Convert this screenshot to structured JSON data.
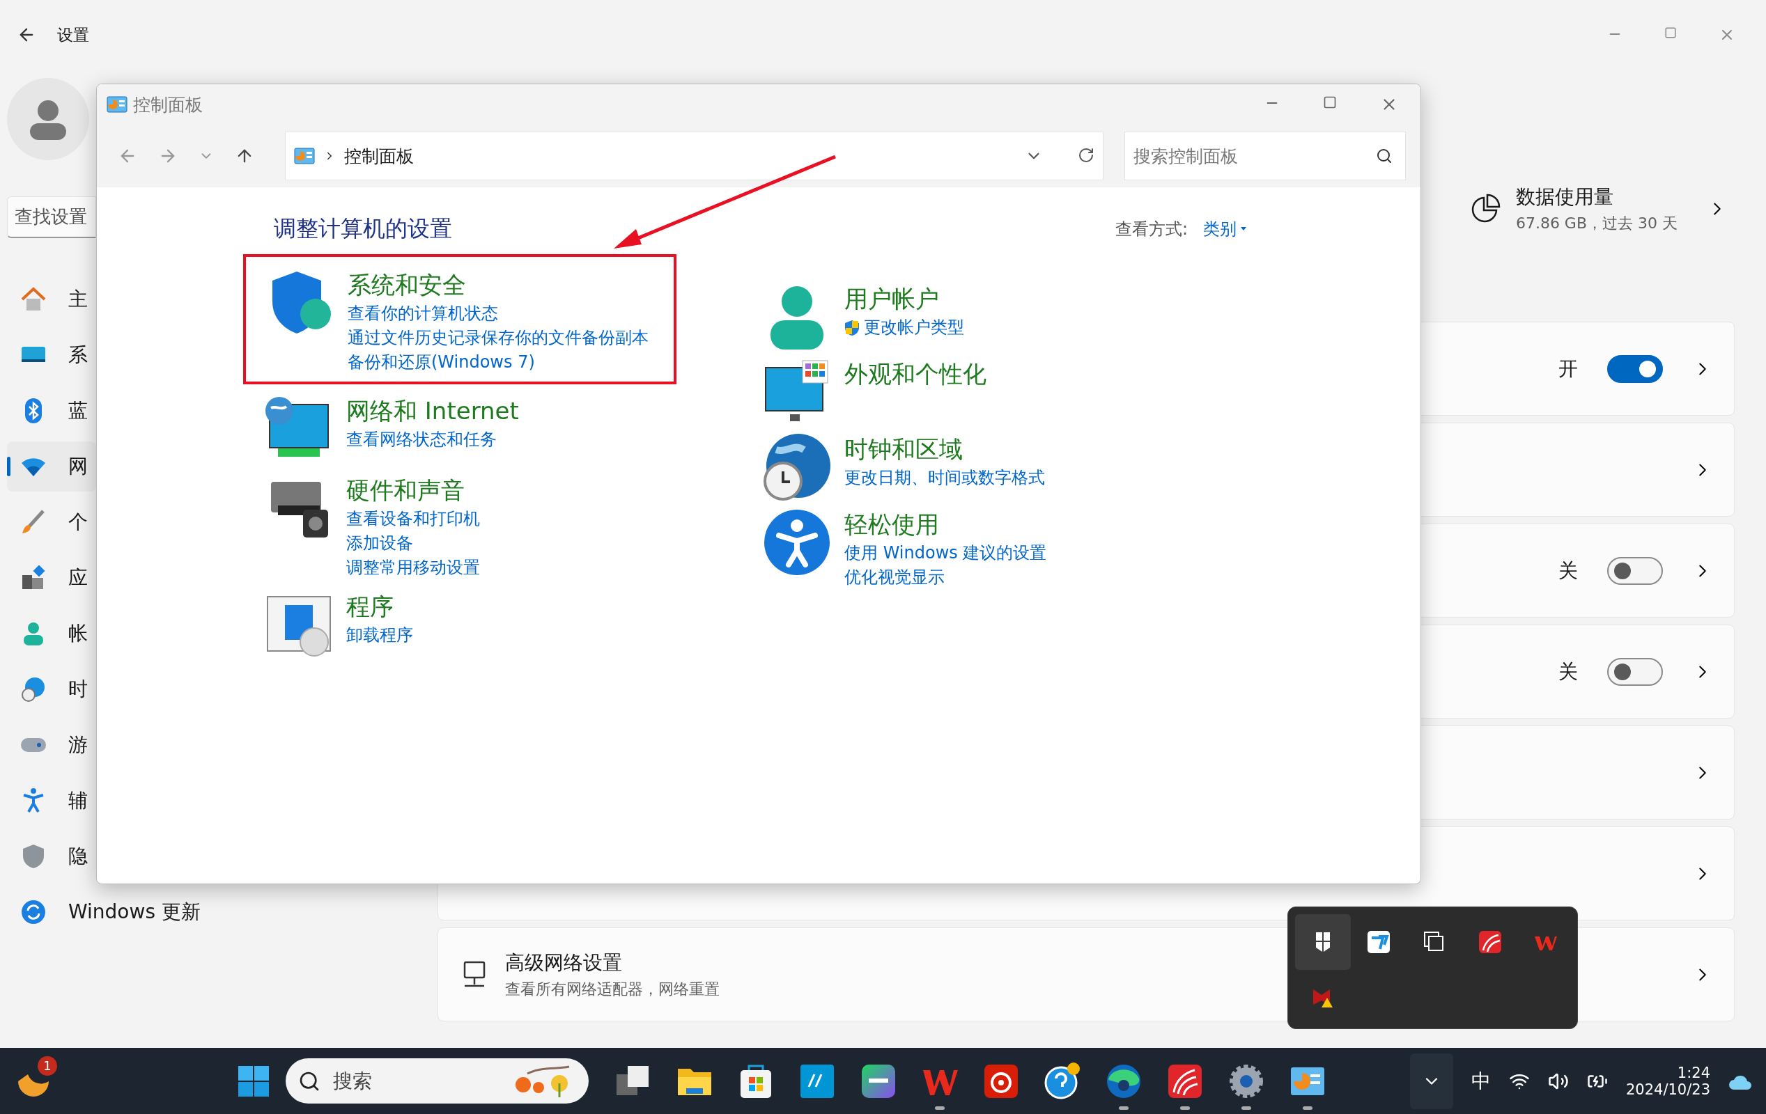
{
  "settings": {
    "title": "设置",
    "search_placeholder": "查找设置",
    "nav": [
      {
        "kind": "home",
        "label": "主",
        "selected": false
      },
      {
        "kind": "system",
        "label": "系",
        "selected": false
      },
      {
        "kind": "bluetooth",
        "label": "蓝",
        "selected": false
      },
      {
        "kind": "network",
        "label": "网",
        "selected": true
      },
      {
        "kind": "brush",
        "label": "个",
        "selected": false
      },
      {
        "kind": "apps",
        "label": "应",
        "selected": false
      },
      {
        "kind": "account",
        "label": "帐",
        "selected": false
      },
      {
        "kind": "time",
        "label": "时",
        "selected": false
      },
      {
        "kind": "gaming",
        "label": "游",
        "selected": false
      },
      {
        "kind": "accessibility",
        "label": "辅",
        "selected": false
      },
      {
        "kind": "privacy",
        "label": "隐",
        "selected": false
      },
      {
        "kind": "update",
        "label": "Windows 更新",
        "selected": false
      }
    ],
    "data_usage": {
      "title": "数据使用量",
      "detail": "67.86 GB，过去 30 天"
    },
    "cards": [
      {
        "kind": "toggle",
        "state_label": "开",
        "on": true
      },
      {
        "kind": "plain"
      },
      {
        "kind": "toggle",
        "state_label": "关",
        "on": false
      },
      {
        "kind": "toggle",
        "state_label": "关",
        "on": false
      },
      {
        "kind": "plain"
      },
      {
        "kind": "plain"
      },
      {
        "kind": "entry",
        "title": "高级网络设置",
        "subtitle": "查看所有网络适配器，网络重置"
      }
    ]
  },
  "control_panel": {
    "title": "控制面板",
    "breadcrumb": "控制面板",
    "search_placeholder": "搜索控制面板",
    "heading": "调整计算机的设置",
    "view_label": "查看方式:",
    "view_value": "类别",
    "columns": [
      [
        {
          "kind": "security",
          "highlighted": true,
          "title": "系统和安全",
          "links": [
            {
              "text": "查看你的计算机状态",
              "shield": false
            },
            {
              "text": "通过文件历史记录保存你的文件备份副本",
              "shield": false
            },
            {
              "text": "备份和还原(Windows 7)",
              "shield": false
            }
          ]
        },
        {
          "kind": "network",
          "highlighted": false,
          "title": "网络和 Internet",
          "links": [
            {
              "text": "查看网络状态和任务",
              "shield": false
            }
          ]
        },
        {
          "kind": "hardware",
          "highlighted": false,
          "title": "硬件和声音",
          "links": [
            {
              "text": "查看设备和打印机",
              "shield": false
            },
            {
              "text": "添加设备",
              "shield": false
            },
            {
              "text": "调整常用移动设置",
              "shield": false
            }
          ]
        },
        {
          "kind": "programs",
          "highlighted": false,
          "title": "程序",
          "links": [
            {
              "text": "卸载程序",
              "shield": false
            }
          ]
        }
      ],
      [
        {
          "kind": "accounts",
          "highlighted": false,
          "title": "用户帐户",
          "links": [
            {
              "text": "更改帐户类型",
              "shield": true
            }
          ]
        },
        {
          "kind": "appearance",
          "highlighted": false,
          "title": "外观和个性化"
        },
        {
          "kind": "clock",
          "highlighted": false,
          "title": "时钟和区域",
          "links": [
            {
              "text": "更改日期、时间或数字格式",
              "shield": false
            }
          ]
        },
        {
          "kind": "ease",
          "highlighted": false,
          "title": "轻松使用",
          "links": [
            {
              "text": "使用 Windows 建议的设置",
              "shield": false
            },
            {
              "text": "优化视觉显示",
              "shield": false
            }
          ]
        }
      ]
    ]
  },
  "tray_popup": [
    {
      "kind": "pin",
      "selected": true
    },
    {
      "kind": "todesk",
      "selected": false
    },
    {
      "kind": "copy",
      "selected": false
    },
    {
      "kind": "chaoxing",
      "selected": false
    },
    {
      "kind": "wps",
      "selected": false
    },
    {
      "kind": "mcafee",
      "selected": false
    }
  ],
  "taskbar": {
    "weather_badge": "1",
    "search_placeholder": "搜索",
    "apps": [
      {
        "kind": "taskview",
        "running": false
      },
      {
        "kind": "explorer",
        "running": false
      },
      {
        "kind": "store",
        "running": false
      },
      {
        "kind": "myhp",
        "running": false
      },
      {
        "kind": "iqiyi",
        "running": false
      },
      {
        "kind": "wps",
        "running": true
      },
      {
        "kind": "music",
        "running": false
      },
      {
        "kind": "help",
        "running": false
      },
      {
        "kind": "edge",
        "running": true
      },
      {
        "kind": "chaoxing",
        "running": true
      },
      {
        "kind": "settings",
        "running": true
      },
      {
        "kind": "controlpanel",
        "running": true
      }
    ],
    "ime": "中",
    "time": "1:24",
    "date": "2024/10/23"
  }
}
